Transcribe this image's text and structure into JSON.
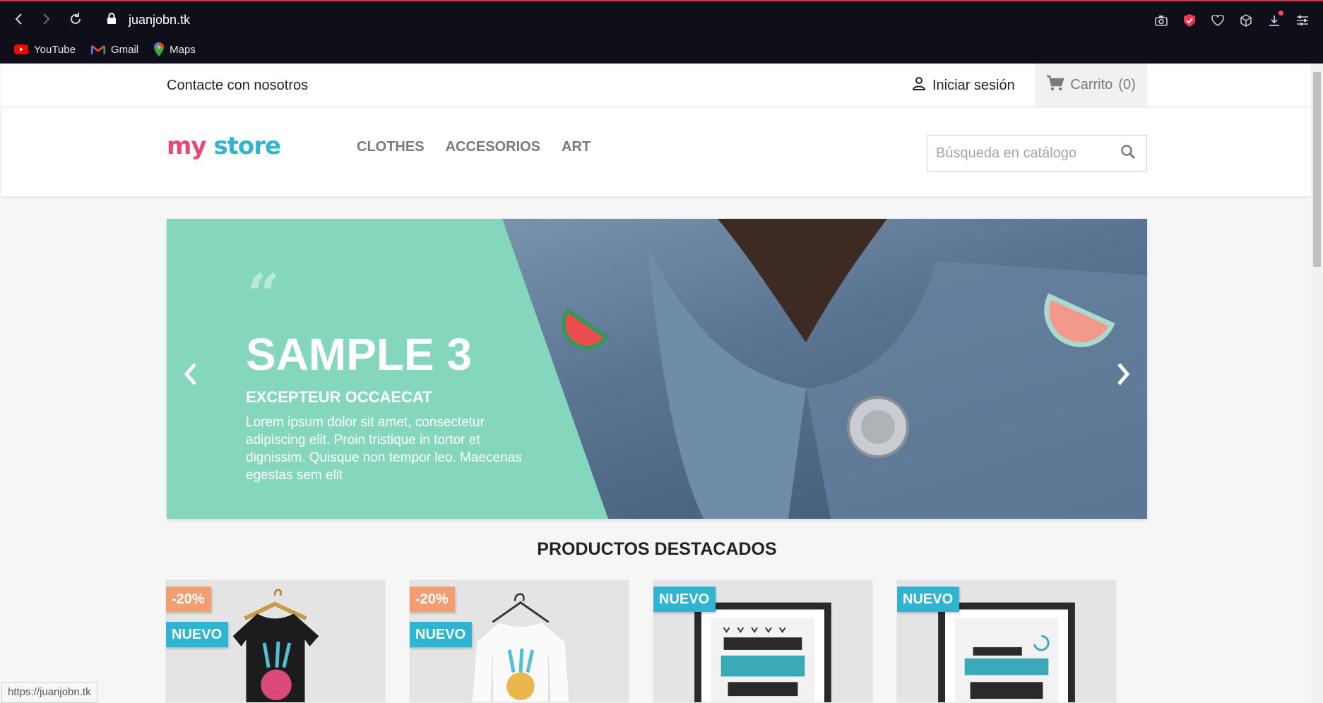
{
  "browser": {
    "url": "juanjobn.tk",
    "bookmarks": [
      {
        "label": "YouTube",
        "icon": "youtube-icon"
      },
      {
        "label": "Gmail",
        "icon": "gmail-icon"
      },
      {
        "label": "Maps",
        "icon": "maps-icon"
      }
    ],
    "status_url": "https://juanjobn.tk"
  },
  "topbar": {
    "contact": "Contacte con nosotros",
    "login": "Iniciar sesión",
    "cart": "Carrito",
    "cart_count": "(0)"
  },
  "header": {
    "logo_word1": "my",
    "logo_word2": "store",
    "menu": [
      "CLOTHES",
      "ACCESORIOS",
      "ART"
    ],
    "search_placeholder": "Búsqueda en catálogo"
  },
  "slider": {
    "title": "SAMPLE 3",
    "subtitle": "EXCEPTEUR OCCAECAT",
    "description": "Lorem ipsum dolor sit amet, consectetur adipiscing elit. Proin tristique in tortor et dignissim. Quisque non tempor leo. Maecenas egestas sem elit",
    "quote_mark": "“"
  },
  "featured": {
    "title": "PRODUCTOS DESTACADOS",
    "products": [
      {
        "discount": "-20%",
        "badge": "NUEVO"
      },
      {
        "discount": "-20%",
        "badge": "NUEVO"
      },
      {
        "badge": "NUEVO"
      },
      {
        "badge": "NUEVO"
      }
    ]
  },
  "colors": {
    "accent": "#2fb5d2",
    "discount": "#f39d72",
    "slide_green": "#84d6bc",
    "browser_bg": "#0f0f1a"
  }
}
